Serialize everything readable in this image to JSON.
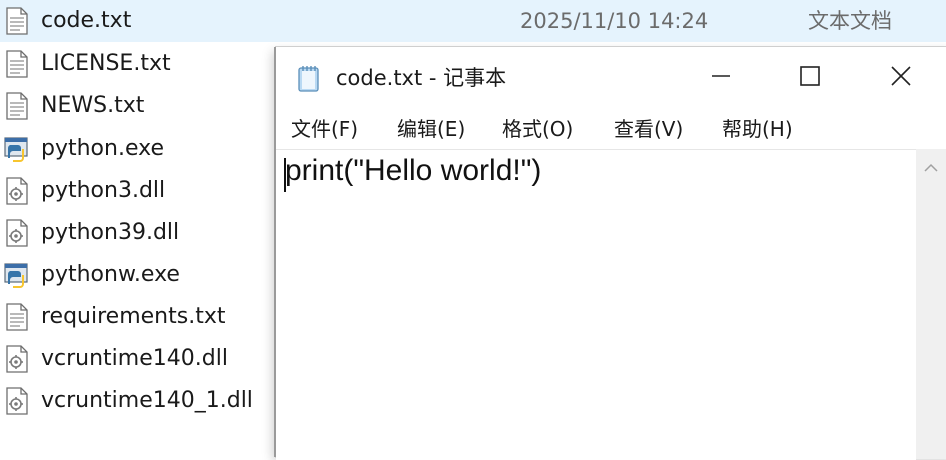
{
  "explorer": {
    "files": [
      {
        "name": "code.txt",
        "date": "2025/11/10 14:24",
        "type": "文本文档",
        "icon": "text-file-icon",
        "selected": true
      },
      {
        "name": "LICENSE.txt",
        "icon": "text-file-icon"
      },
      {
        "name": "NEWS.txt",
        "icon": "text-file-icon"
      },
      {
        "name": "python.exe",
        "icon": "python-exe-icon"
      },
      {
        "name": "python3.dll",
        "icon": "dll-file-icon"
      },
      {
        "name": "python39.dll",
        "icon": "dll-file-icon"
      },
      {
        "name": "pythonw.exe",
        "icon": "python-exe-icon"
      },
      {
        "name": "requirements.txt",
        "icon": "text-file-icon"
      },
      {
        "name": "vcruntime140.dll",
        "icon": "dll-file-icon"
      },
      {
        "name": "vcruntime140_1.dll",
        "icon": "dll-file-icon"
      }
    ]
  },
  "notepad": {
    "title": "code.txt - 记事本",
    "icon": "notepad-icon",
    "controls": {
      "minimize": "minimize-icon",
      "maximize": "maximize-icon",
      "close": "close-icon"
    },
    "menu": [
      "文件(F)",
      "编辑(E)",
      "格式(O)",
      "查看(V)",
      "帮助(H)"
    ],
    "content": "print(\"Hello world!\")"
  },
  "colors": {
    "selected_row": "#e5f3fd",
    "text": "#1a1a1a",
    "muted_text": "#6b6b6b",
    "scrollbar": "#f0f0f0"
  }
}
